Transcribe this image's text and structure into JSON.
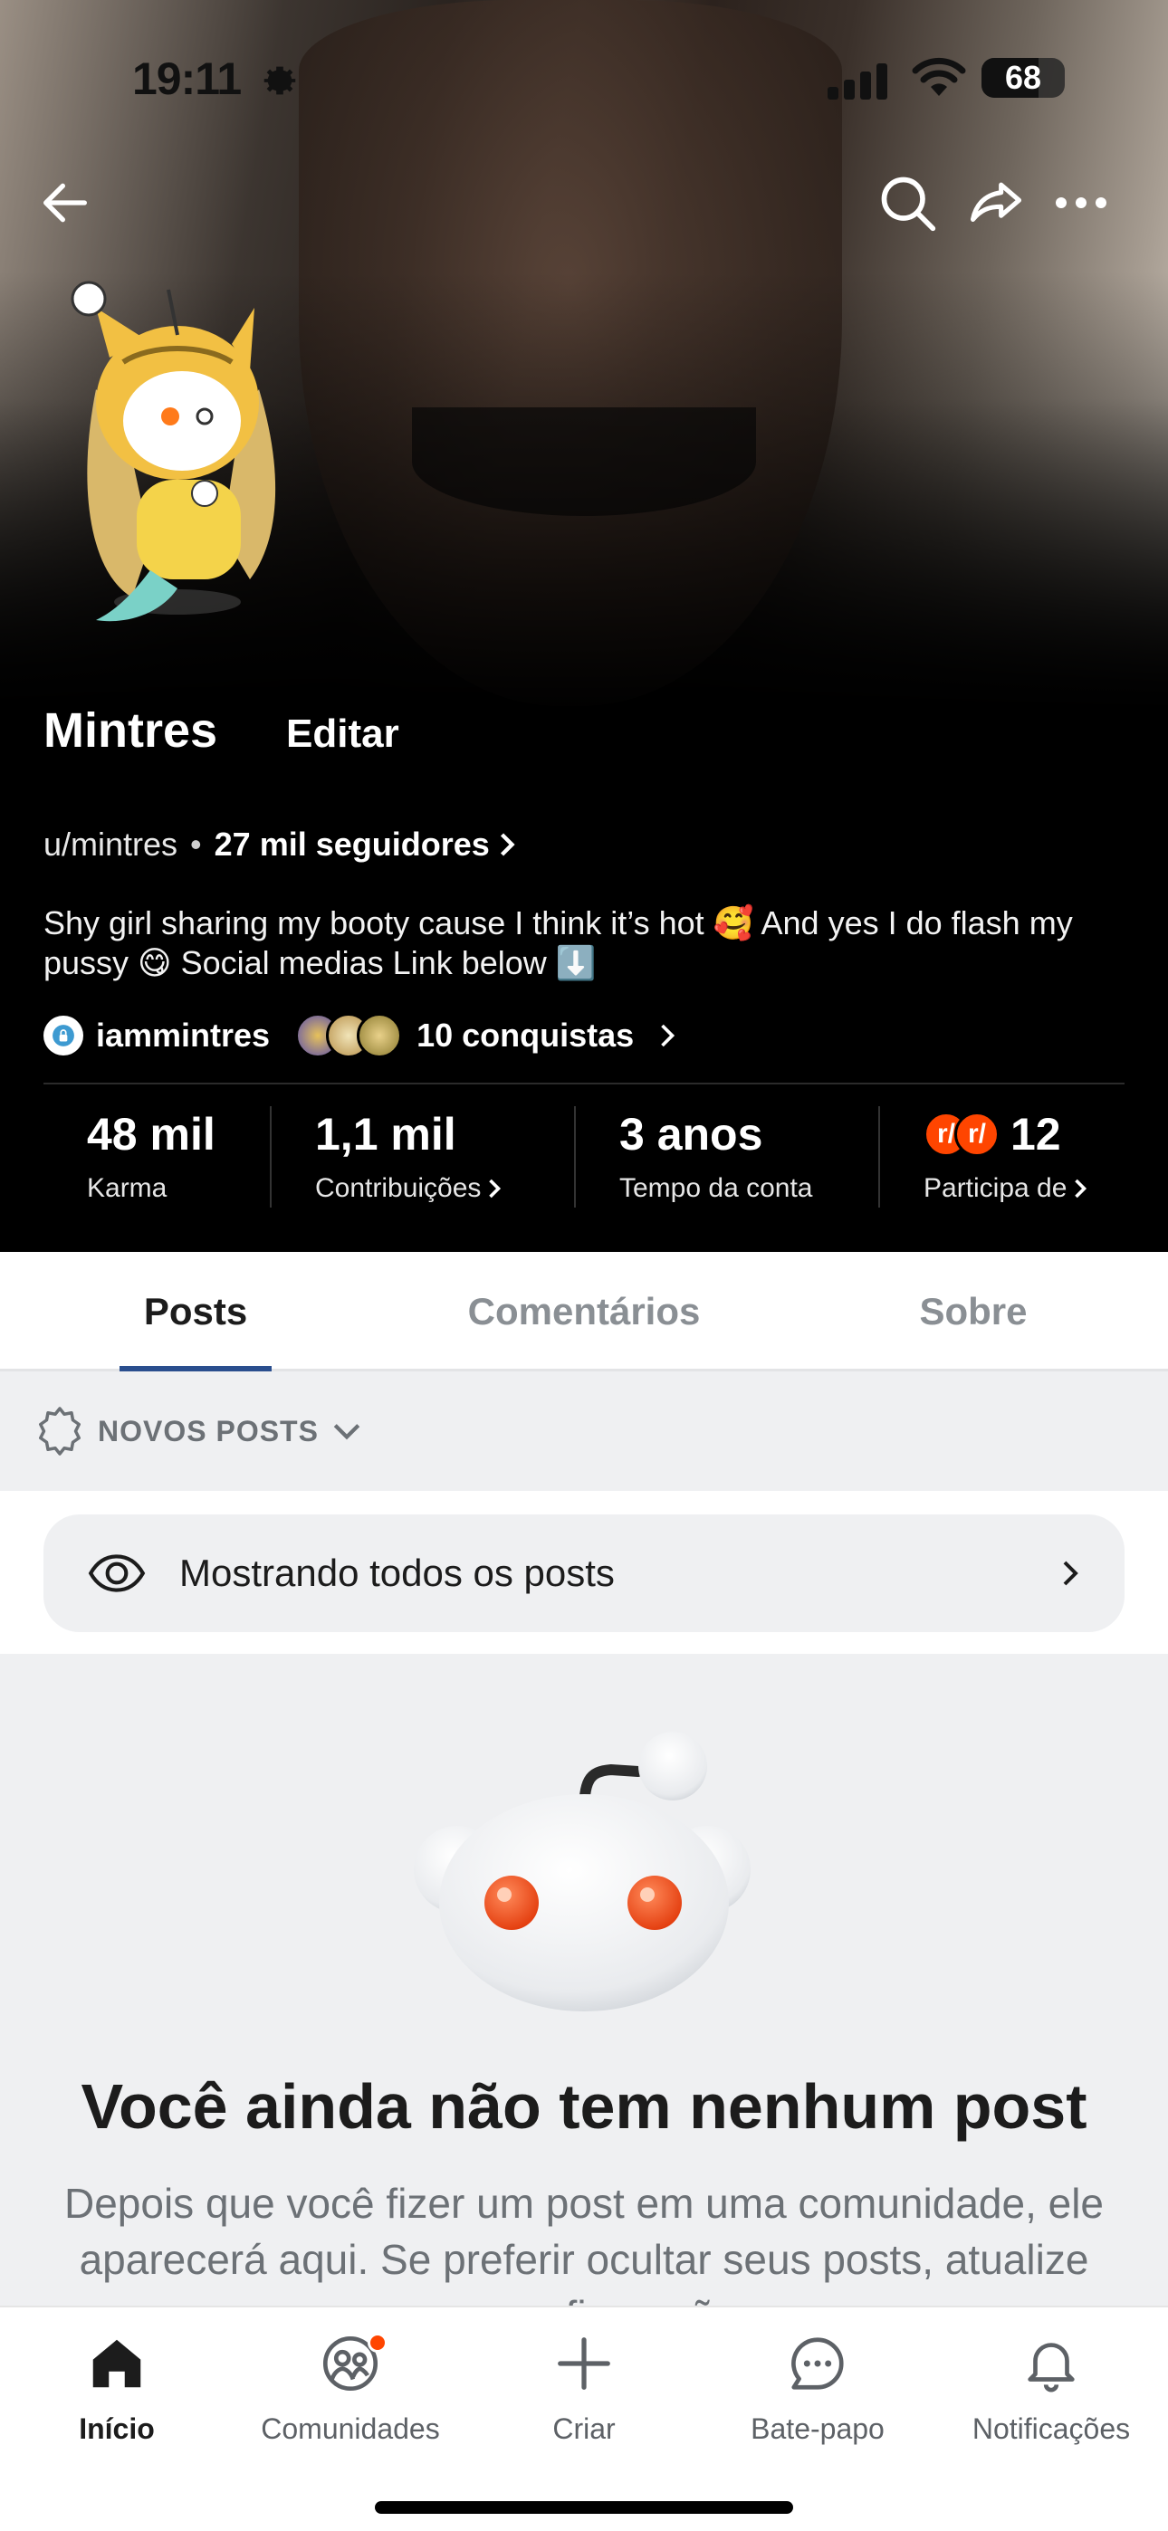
{
  "status_bar": {
    "time": "19:11",
    "battery": "68",
    "battery_level": 0.68
  },
  "header_nav": {
    "back_icon": "arrow-left-icon",
    "search_icon": "search-icon",
    "share_icon": "share-icon",
    "more_icon": "ellipsis-icon"
  },
  "profile": {
    "name": "Mintres",
    "edit_label": "Editar",
    "username": "u/mintres",
    "separator": "•",
    "followers": "27 mil seguidores",
    "bio": "Shy girl sharing my booty cause I think it’s hot 🥰 And yes I do flash my pussy 😋 Social medias Link below ⬇️",
    "social_link": "iammintres",
    "achievements": "10 conquistas"
  },
  "stats": [
    {
      "value": "48 mil",
      "label": "Karma"
    },
    {
      "value": "1,1 mil",
      "label": "Contribuições"
    },
    {
      "value": "3 anos",
      "label": "Tempo da conta"
    },
    {
      "value": "12",
      "label": "Participa de"
    }
  ],
  "subreddit_badges": [
    "r/",
    "r/"
  ],
  "tabs": [
    {
      "label": "Posts",
      "active": true
    },
    {
      "label": "Comentários",
      "active": false
    },
    {
      "label": "Sobre",
      "active": false
    }
  ],
  "sort": {
    "label": "NOVOS POSTS"
  },
  "filter": {
    "label": "Mostrando todos os posts"
  },
  "empty_state": {
    "title": "Você ainda não tem nenhum post",
    "body": "Depois que você fizer um post em uma comunidade, ele aparecerá aqui. Se preferir ocultar seus posts, atualize suas configurações."
  },
  "bottom_nav": [
    {
      "label": "Início",
      "icon": "home-icon",
      "active": true
    },
    {
      "label": "Comunidades",
      "icon": "communities-icon",
      "active": false
    },
    {
      "label": "Criar",
      "icon": "plus-icon",
      "active": false
    },
    {
      "label": "Bate-papo",
      "icon": "chat-icon",
      "active": false
    },
    {
      "label": "Notificações",
      "icon": "bell-icon",
      "active": false
    }
  ],
  "colors": {
    "accent": "#2a4e8e",
    "reddit_orange": "#ff4500",
    "header_bg": "#000000",
    "page_bg": "#eff0f2"
  }
}
